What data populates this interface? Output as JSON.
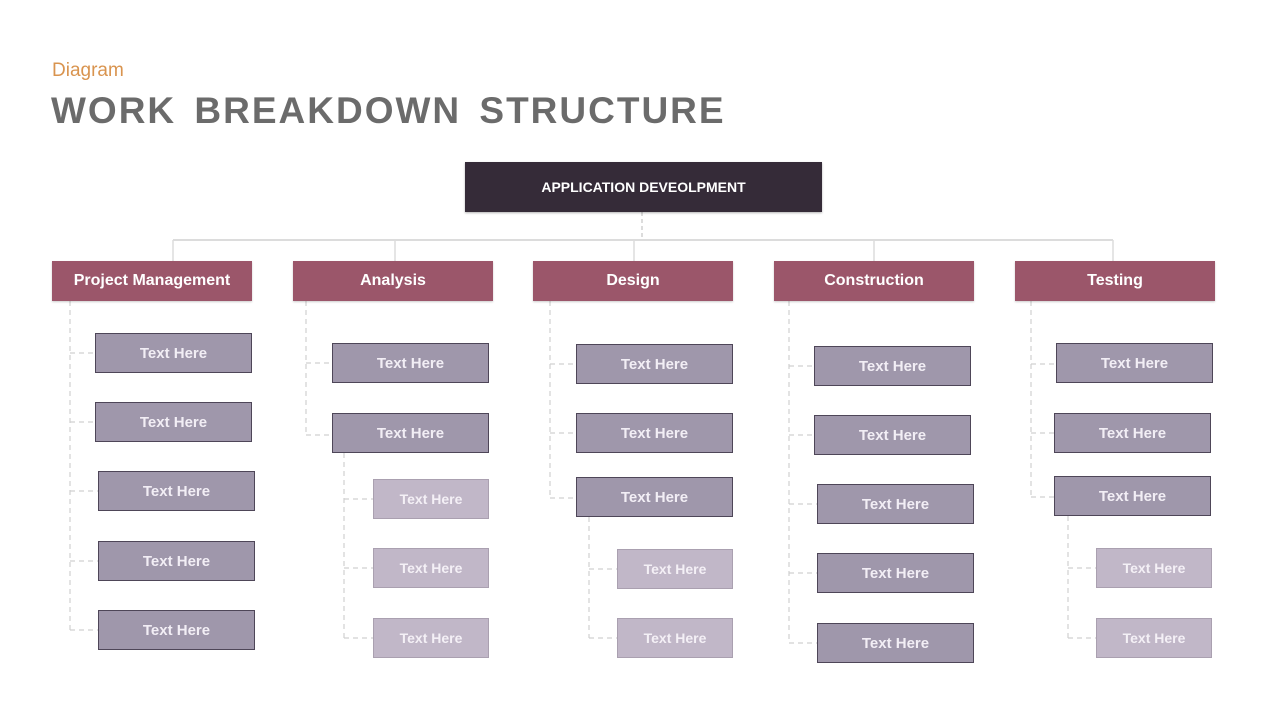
{
  "header": {
    "subtitle": "Diagram",
    "title": "WORK BREAKDOWN STRUCTURE"
  },
  "colors": {
    "root_fill": "#352b38",
    "category_fill": "#9b566a",
    "level1_fill": "#9f97ab",
    "level2_fill": "#c1b7c8",
    "subtitle": "#d9944f",
    "title": "#6b6b6b",
    "connector": "#d0d0d0"
  },
  "root": {
    "label": "APPLICATION DEVEOLPMENT"
  },
  "categories": [
    {
      "label": "Project Management",
      "items": [
        {
          "label": "Text Here",
          "children": []
        },
        {
          "label": "Text Here",
          "children": []
        },
        {
          "label": "Text Here",
          "children": []
        },
        {
          "label": "Text Here",
          "children": []
        },
        {
          "label": "Text Here",
          "children": []
        }
      ]
    },
    {
      "label": "Analysis",
      "items": [
        {
          "label": "Text Here",
          "children": []
        },
        {
          "label": "Text Here",
          "children": [
            {
              "label": "Text Here"
            },
            {
              "label": "Text Here"
            },
            {
              "label": "Text Here"
            }
          ]
        }
      ]
    },
    {
      "label": "Design",
      "items": [
        {
          "label": "Text Here",
          "children": []
        },
        {
          "label": "Text Here",
          "children": []
        },
        {
          "label": "Text Here",
          "children": [
            {
              "label": "Text Here"
            },
            {
              "label": "Text Here"
            }
          ]
        }
      ]
    },
    {
      "label": "Construction",
      "items": [
        {
          "label": "Text Here",
          "children": []
        },
        {
          "label": "Text Here",
          "children": []
        },
        {
          "label": "Text Here",
          "children": []
        },
        {
          "label": "Text Here",
          "children": []
        },
        {
          "label": "Text Here",
          "children": []
        }
      ]
    },
    {
      "label": "Testing",
      "items": [
        {
          "label": "Text Here",
          "children": []
        },
        {
          "label": "Text Here",
          "children": []
        },
        {
          "label": "Text Here",
          "children": [
            {
              "label": "Text Here"
            },
            {
              "label": "Text Here"
            }
          ]
        }
      ]
    }
  ]
}
